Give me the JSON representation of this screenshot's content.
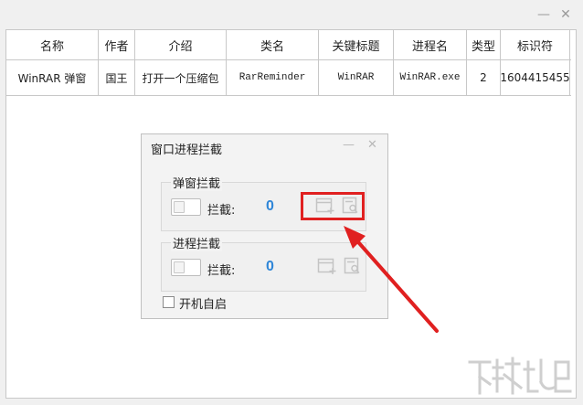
{
  "window": {
    "minimize_glyph": "—",
    "close_glyph": "✕"
  },
  "table": {
    "columns": [
      "名称",
      "作者",
      "介绍",
      "类名",
      "关键标题",
      "进程名",
      "类型",
      "标识符"
    ],
    "rows": [
      [
        "WinRAR 弹窗",
        "国王",
        "打开一个压缩包",
        "RarReminder",
        "WinRAR",
        "WinRAR.exe",
        "2",
        "1604415455"
      ]
    ]
  },
  "dialog": {
    "title": "窗口进程拦截",
    "minimize_glyph": "—",
    "close_glyph": "✕",
    "popup_group": {
      "label": "弹窗拦截",
      "intercept_label": "拦截:",
      "count": "0"
    },
    "process_group": {
      "label": "进程拦截",
      "intercept_label": "拦截:",
      "count": "0"
    },
    "autostart": {
      "label": "开机自启",
      "checked": false
    }
  },
  "annotation": {
    "highlight_color": "#e02020",
    "arrow_color": "#e02020"
  },
  "colors": {
    "count_blue": "#2f86d8",
    "background": "#f0f0f0"
  }
}
